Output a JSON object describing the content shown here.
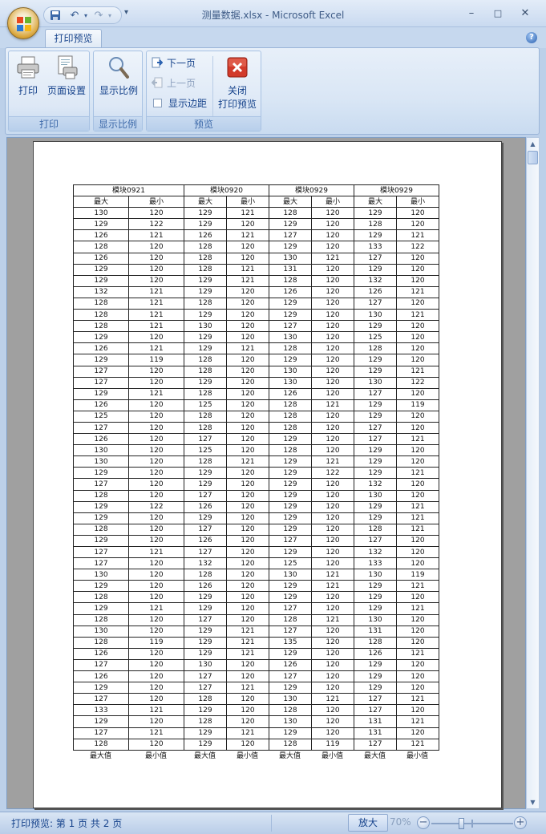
{
  "window": {
    "title": "测量数据.xlsx - Microsoft Excel",
    "minimize": "–",
    "maximize": "□",
    "close": "✕"
  },
  "ribbon": {
    "active_tab": "打印预览",
    "groups": {
      "print": {
        "label": "打印",
        "print_button": "打印",
        "page_setup_button": "页面设置"
      },
      "zoom": {
        "label": "显示比例",
        "zoom_button": "显示比例"
      },
      "preview": {
        "label": "预览",
        "next_page": "下一页",
        "prev_page": "上一页",
        "show_margins": "显示边距",
        "close_preview_line1": "关闭",
        "close_preview_line2": "打印预览"
      }
    }
  },
  "sheet": {
    "headers": [
      "模块0921",
      "模块0920",
      "模块0929",
      "模块0929"
    ],
    "sub_headers": [
      "最大",
      "最小",
      "最大",
      "最小",
      "最大",
      "最小",
      "最大",
      "最小"
    ],
    "rows": [
      [
        130,
        120,
        129,
        121,
        128,
        120,
        129,
        120
      ],
      [
        129,
        122,
        129,
        120,
        129,
        120,
        128,
        120
      ],
      [
        126,
        121,
        126,
        121,
        127,
        120,
        129,
        121
      ],
      [
        128,
        120,
        128,
        120,
        129,
        120,
        133,
        122
      ],
      [
        126,
        120,
        128,
        120,
        130,
        121,
        127,
        120
      ],
      [
        129,
        120,
        128,
        121,
        131,
        120,
        129,
        120
      ],
      [
        129,
        120,
        129,
        121,
        128,
        120,
        132,
        120
      ],
      [
        132,
        121,
        129,
        120,
        126,
        120,
        126,
        121
      ],
      [
        128,
        121,
        128,
        120,
        129,
        120,
        127,
        120
      ],
      [
        128,
        121,
        129,
        120,
        129,
        120,
        130,
        121
      ],
      [
        128,
        121,
        130,
        120,
        127,
        120,
        129,
        120
      ],
      [
        129,
        120,
        129,
        120,
        130,
        120,
        125,
        120
      ],
      [
        126,
        121,
        129,
        121,
        128,
        120,
        128,
        120
      ],
      [
        129,
        119,
        128,
        120,
        129,
        120,
        129,
        120
      ],
      [
        127,
        120,
        128,
        120,
        130,
        120,
        129,
        121
      ],
      [
        127,
        120,
        129,
        120,
        130,
        120,
        130,
        122
      ],
      [
        129,
        121,
        128,
        120,
        126,
        120,
        127,
        120
      ],
      [
        126,
        120,
        125,
        120,
        128,
        121,
        129,
        119
      ],
      [
        125,
        120,
        128,
        120,
        128,
        120,
        129,
        120
      ],
      [
        127,
        120,
        128,
        120,
        128,
        120,
        127,
        120
      ],
      [
        126,
        120,
        127,
        120,
        129,
        120,
        127,
        121
      ],
      [
        130,
        120,
        125,
        120,
        128,
        120,
        129,
        120
      ],
      [
        130,
        120,
        128,
        121,
        129,
        121,
        129,
        120
      ],
      [
        129,
        120,
        129,
        120,
        129,
        122,
        129,
        121
      ],
      [
        127,
        120,
        129,
        120,
        129,
        120,
        132,
        120
      ],
      [
        128,
        120,
        127,
        120,
        129,
        120,
        130,
        120
      ],
      [
        129,
        122,
        126,
        120,
        129,
        120,
        129,
        121
      ],
      [
        129,
        120,
        129,
        120,
        129,
        120,
        129,
        121
      ],
      [
        128,
        120,
        127,
        120,
        129,
        120,
        128,
        121
      ],
      [
        129,
        120,
        126,
        120,
        127,
        120,
        127,
        120
      ],
      [
        127,
        121,
        127,
        120,
        129,
        120,
        132,
        120
      ],
      [
        127,
        120,
        132,
        120,
        125,
        120,
        133,
        120
      ],
      [
        130,
        120,
        128,
        120,
        130,
        121,
        130,
        119
      ],
      [
        129,
        120,
        126,
        120,
        129,
        121,
        129,
        121
      ],
      [
        128,
        120,
        129,
        120,
        129,
        120,
        129,
        120
      ],
      [
        129,
        121,
        129,
        120,
        127,
        120,
        129,
        121
      ],
      [
        128,
        120,
        127,
        120,
        128,
        121,
        130,
        120
      ],
      [
        130,
        120,
        129,
        121,
        127,
        120,
        131,
        120
      ],
      [
        128,
        119,
        129,
        121,
        135,
        120,
        128,
        120
      ],
      [
        126,
        120,
        129,
        121,
        129,
        120,
        126,
        121
      ],
      [
        127,
        120,
        130,
        120,
        126,
        120,
        129,
        120
      ],
      [
        126,
        120,
        127,
        120,
        127,
        120,
        129,
        120
      ],
      [
        129,
        120,
        127,
        121,
        129,
        120,
        129,
        120
      ],
      [
        127,
        120,
        128,
        120,
        130,
        121,
        127,
        121
      ],
      [
        133,
        121,
        129,
        120,
        128,
        120,
        127,
        120
      ],
      [
        129,
        120,
        128,
        120,
        130,
        120,
        131,
        121
      ],
      [
        127,
        121,
        129,
        121,
        129,
        120,
        131,
        120
      ],
      [
        128,
        120,
        129,
        120,
        128,
        119,
        127,
        121
      ]
    ],
    "footer": [
      "最大值",
      "最小值",
      "最大值",
      "最小值",
      "最大值",
      "最小值",
      "最大值",
      "最小值"
    ]
  },
  "status": {
    "page_info": "打印预览: 第 1 页  共 2 页",
    "zoom_button": "放大",
    "zoom_level": "70%",
    "zoom_minus": "−",
    "zoom_plus": "+"
  }
}
